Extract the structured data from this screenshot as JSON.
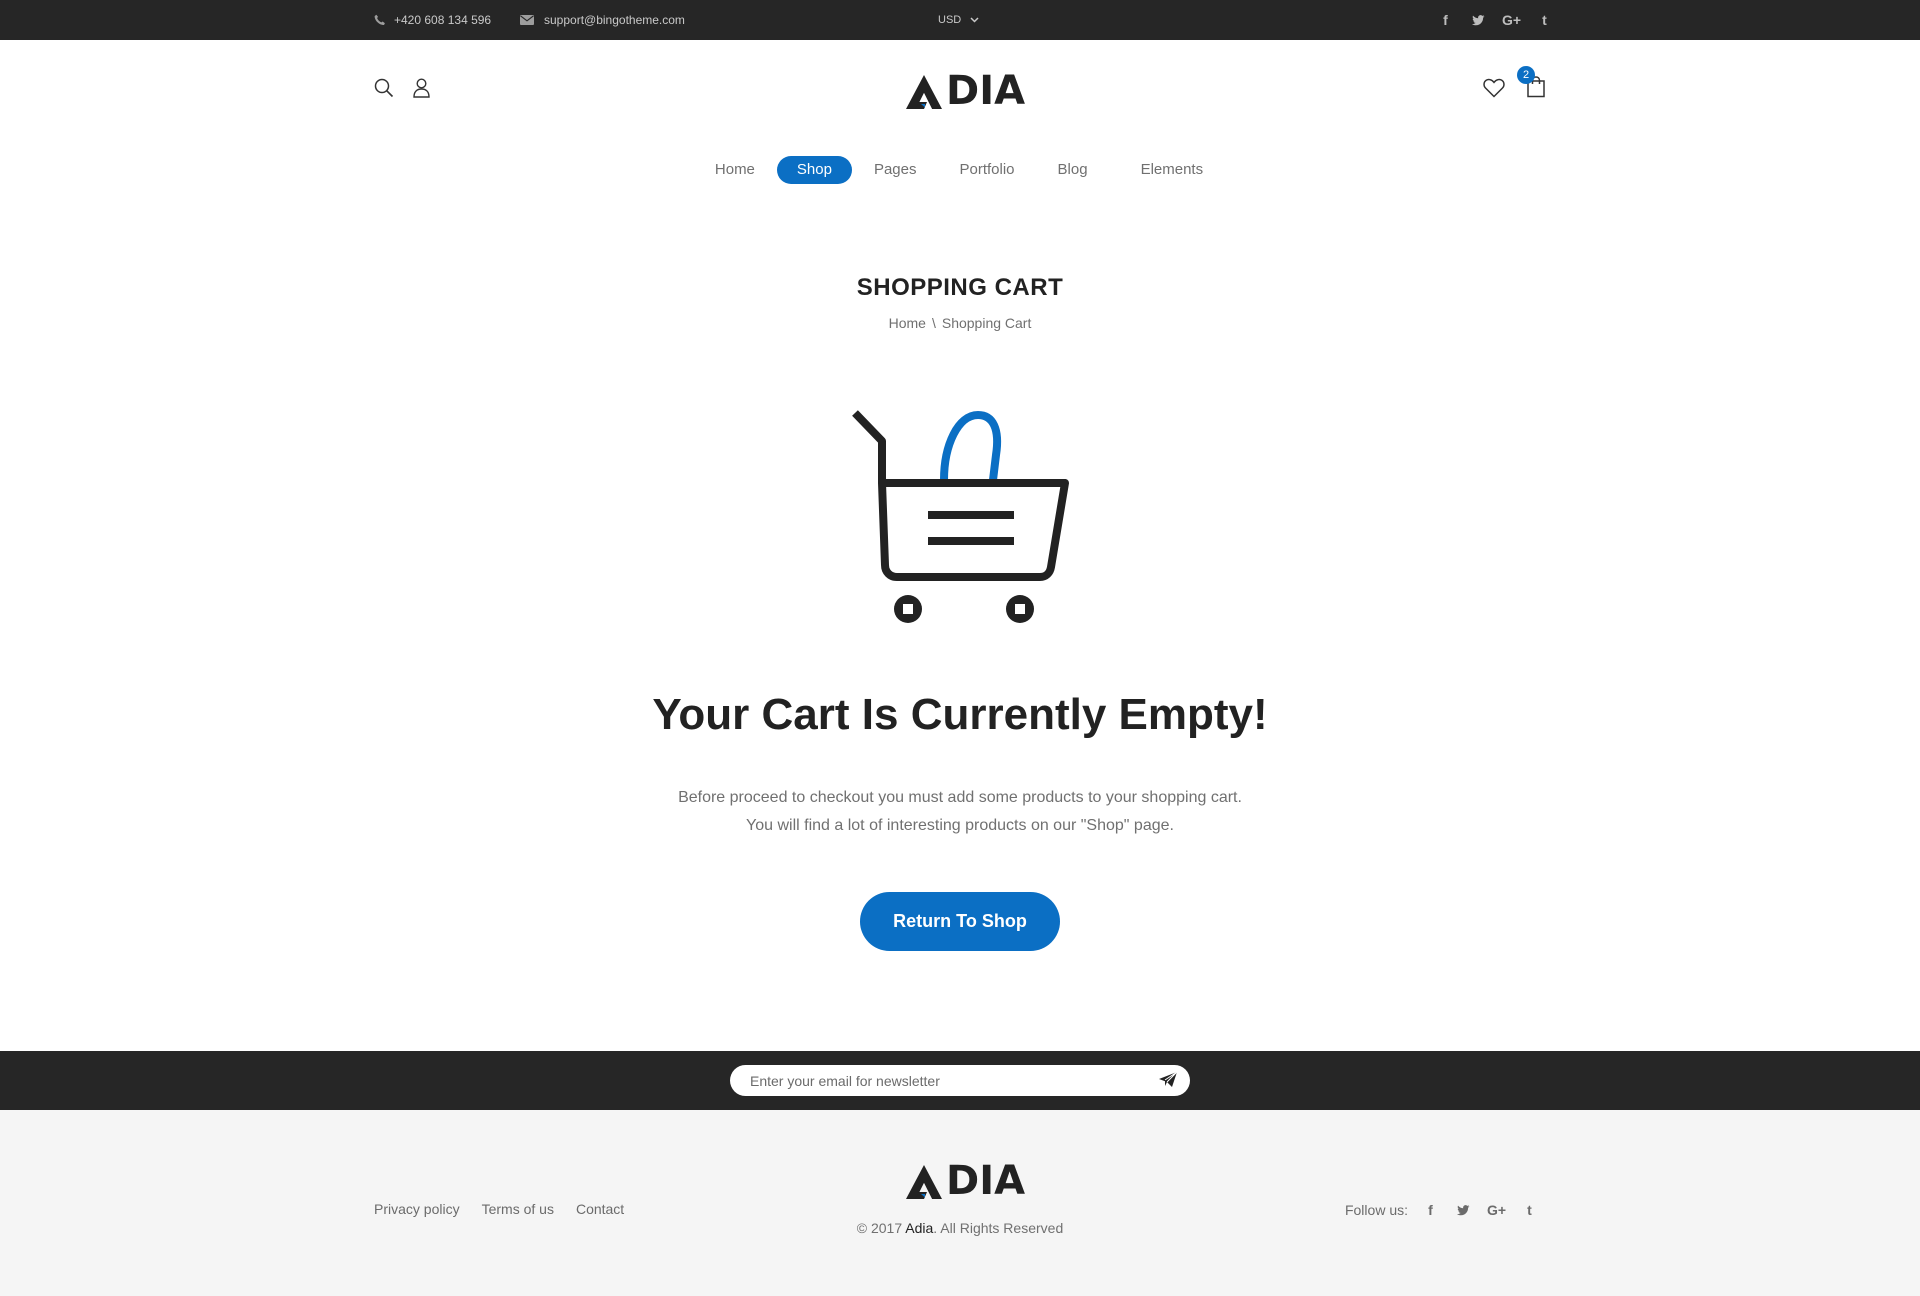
{
  "topbar": {
    "phone": "+420 608 134 596",
    "email": "support@bingotheme.com",
    "currency": "USD",
    "social": [
      "f",
      "t",
      "G+",
      "t"
    ]
  },
  "header": {
    "logo_text": "DIA",
    "cart_count": "2"
  },
  "nav": {
    "items": [
      "Home",
      "Shop",
      "Pages",
      "Portfolio",
      "Blog",
      "Elements"
    ],
    "active": "Shop"
  },
  "page": {
    "title": "SHOPPING CART",
    "breadcrumb_home": "Home",
    "breadcrumb_sep": "\\",
    "breadcrumb_current": "Shopping Cart"
  },
  "empty": {
    "heading": "Your Cart Is Currently Empty!",
    "line1": "Before proceed to checkout you must add some products to your shopping cart.",
    "line2": "You will find a lot of interesting products on our \"Shop\" page.",
    "button": "Return To Shop"
  },
  "newsletter": {
    "placeholder": "Enter your email for newsletter"
  },
  "footer": {
    "links": [
      "Privacy policy",
      "Terms of us",
      "Contact"
    ],
    "logo_text": "DIA",
    "copy_prefix": "© 2017",
    "copy_brand": "Adia",
    "copy_suffix": ". All Rights Reserved",
    "follow_label": "Follow us:",
    "social": [
      "f",
      "t",
      "G+",
      "t"
    ]
  },
  "colors": {
    "accent": "#0b6fc4",
    "dark": "#262626",
    "footer_bg": "#f5f5f5"
  },
  "icons": {
    "topbar_phone": "phone-icon",
    "topbar_email": "mail-icon",
    "search": "search-icon",
    "account": "user-icon",
    "wishlist": "heart-icon",
    "cart": "bag-icon",
    "hero": "shopping-cart-icon",
    "send": "paper-plane-icon"
  }
}
